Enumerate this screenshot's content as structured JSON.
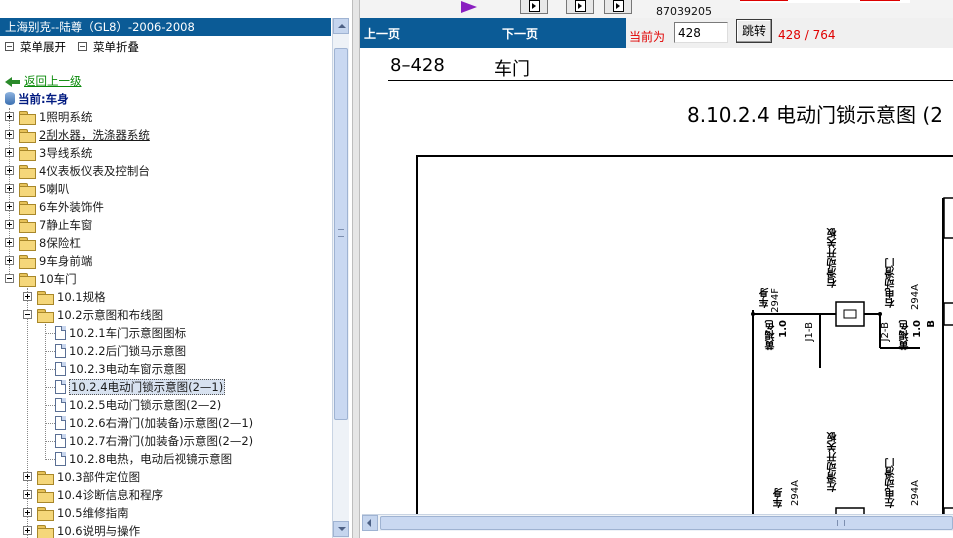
{
  "left_panel": {
    "title": "上海别克--陆尊（GL8）-2006-2008",
    "expand_all": "菜单展开",
    "collapse_all": "菜单折叠",
    "back_link": "返回上一级",
    "current": "当前:车身",
    "tree": [
      {
        "label": "1照明系统"
      },
      {
        "label": "2刮水器，洗涤器系统"
      },
      {
        "label": "3导线系统"
      },
      {
        "label": "4仪表板仪表及控制台"
      },
      {
        "label": "5喇叭"
      },
      {
        "label": "6车外装饰件"
      },
      {
        "label": "7静止车窗"
      },
      {
        "label": "8保险杠"
      },
      {
        "label": "9车身前端"
      },
      {
        "label": "10车门"
      },
      {
        "label": "10.1规格"
      },
      {
        "label": "10.2示意图和布线图"
      },
      {
        "label": "10.2.1车门示意图图标"
      },
      {
        "label": "10.2.2后门锁马示意图"
      },
      {
        "label": "10.2.3电动车窗示意图"
      },
      {
        "label": "10.2.4电动门锁示意图(2—1)"
      },
      {
        "label": "10.2.5电动门锁示意图(2—2)"
      },
      {
        "label": "10.2.6右滑门(加装备)示意图(2—1)"
      },
      {
        "label": "10.2.7右滑门(加装备)示意图(2—2)"
      },
      {
        "label": "10.2.8电热，电动后视镜示意图"
      },
      {
        "label": "10.3部件定位图"
      },
      {
        "label": "10.4诊断信息和程序"
      },
      {
        "label": "10.5维修指南"
      },
      {
        "label": "10.6说明与操作"
      }
    ]
  },
  "topstrip": {
    "number": "87039205"
  },
  "navbar": {
    "prev": "上一页",
    "next": "下一页",
    "current_label": "当前为",
    "page_value": "428",
    "go": "跳转",
    "page_count": "428 / 764"
  },
  "document": {
    "page_code": "8–428",
    "section": "车门",
    "title": "8.10.2.4 电动门锁示意图 (2",
    "labels": {
      "t1": "车身",
      "t2": "294F",
      "t3": "黄褐色",
      "t4": "1.0",
      "t5": "J1-B",
      "t6": "右滑动开关板",
      "t7": "右电动滑门",
      "t8": "294A",
      "t9": "黄褐色",
      "t10": "1.0",
      "t11": "J2-B",
      "t12": "B",
      "t13": "车身",
      "t14": "294A",
      "t15": "左滑动开关板",
      "t16": "左电动滑门",
      "t17": "294A"
    }
  },
  "colors": {
    "title_bar": "#0b5b96",
    "alert_text": "#e00000",
    "back_link": "#0a8a0a",
    "current_text": "#001a80",
    "play_icon": "#8a1fc0"
  }
}
